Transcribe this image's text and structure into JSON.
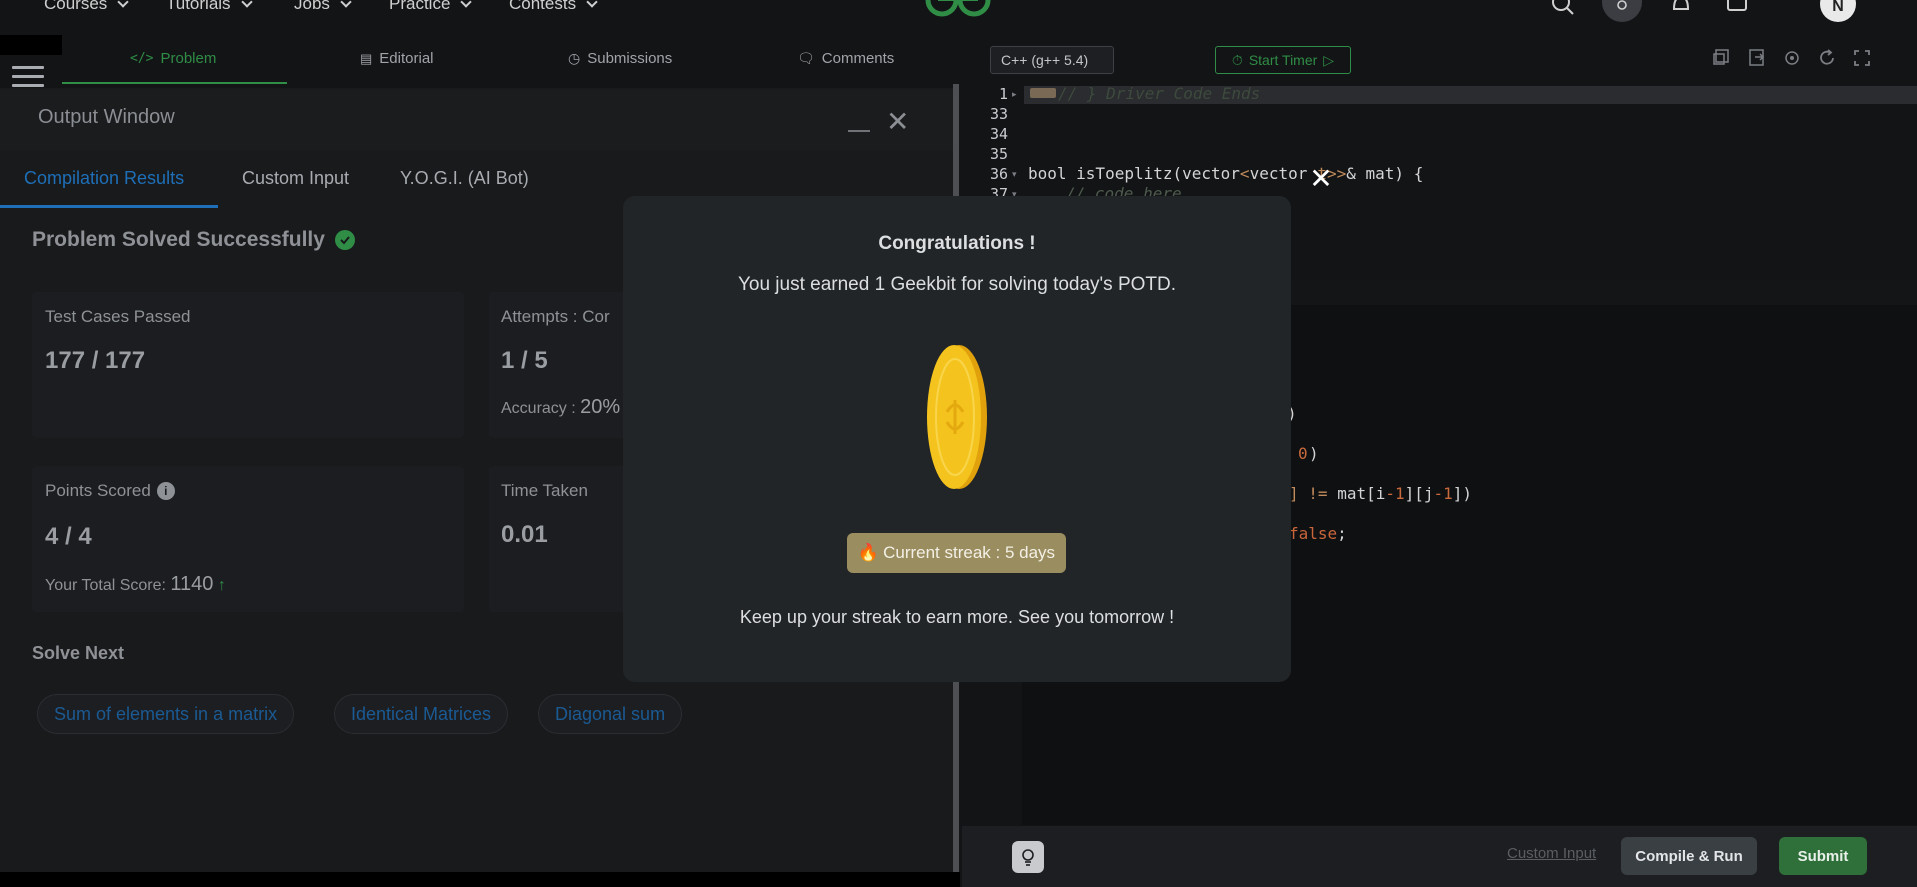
{
  "top_nav": {
    "items": [
      "Courses",
      "Tutorials",
      "Jobs",
      "Practice",
      "Contests"
    ],
    "avatar_initial": "N"
  },
  "problem_tabs": [
    "Problem",
    "Editorial",
    "Submissions",
    "Comments"
  ],
  "output_window": {
    "title": "Output Window",
    "tabs": [
      "Compilation Results",
      "Custom Input",
      "Y.O.G.I. (AI Bot)"
    ],
    "result_title": "Problem Solved Successfully",
    "cards": {
      "test_cases_label": "Test Cases Passed",
      "test_cases_value": "177 / 177",
      "attempts_label": "Attempts : Cor",
      "attempts_value": "1 / 5",
      "accuracy_label": "Accuracy :",
      "accuracy_value": "20%",
      "points_label": "Points Scored",
      "points_value": "4 / 4",
      "total_score_label": "Your Total Score:",
      "total_score_value": "1140",
      "time_label": "Time Taken",
      "time_value": "0.01"
    },
    "solve_next_label": "Solve Next",
    "solve_next": [
      "Sum of elements in a matrix",
      "Identical Matrices",
      "Diagonal sum"
    ]
  },
  "editor": {
    "language": "C++ (g++ 5.4)",
    "start_timer": "Start Timer",
    "line_numbers": [
      "1",
      "33",
      "34",
      "35",
      "36",
      "37"
    ],
    "line1_comment": "// } Driver Code Ends",
    "line36_code": {
      "a": "bool isToeplitz(vector",
      "b": "<",
      "c": "vector",
      "d": "t>>",
      "e": "& mat) {"
    },
    "line37_comment": "// code here",
    "frag_paren": ")",
    "frag_zero": "0",
    "frag_bracket": "]",
    "frag_neq": "!=",
    "frag_mat_a": "mat[i",
    "frag_minus1": "-1",
    "frag_mat_b": "][j",
    "frag_minus2": "-1",
    "frag_close": "])",
    "frag_false": "false",
    "frag_semi": ";",
    "custom_input": "Custom Input",
    "compile_run": "Compile & Run",
    "submit": "Submit"
  },
  "modal": {
    "title": "Congratulations !",
    "subtitle": "You just earned 1 Geekbit for solving today's POTD.",
    "streak": "Current streak : 5 days",
    "footer": "Keep up your streak to earn more. See you tomorrow !"
  },
  "colors": {
    "brand_green": "#2f8d46",
    "link_blue": "#1e6fb8",
    "streak_badge": "#9a8d5f",
    "coin_gold": "#f5c31d"
  }
}
